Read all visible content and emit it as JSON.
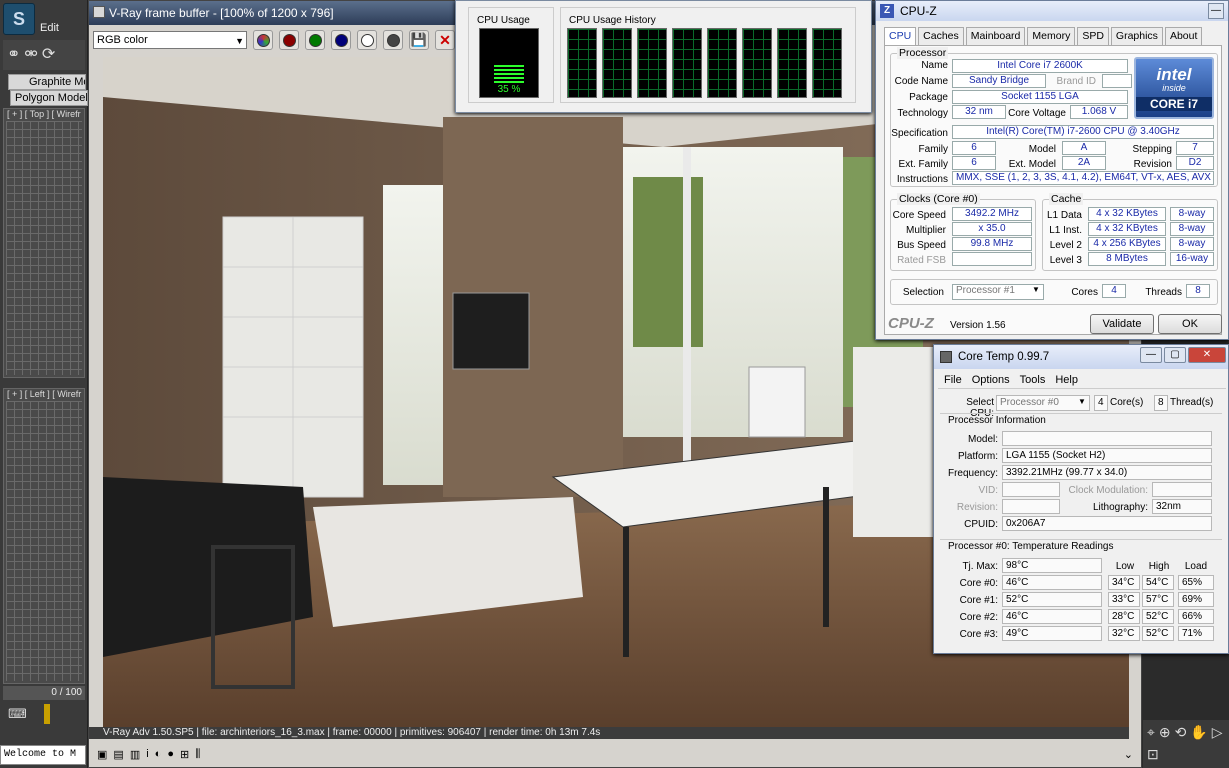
{
  "max": {
    "edit_label": "Edit",
    "ribbon1": "Graphite Mo",
    "ribbon2": "Polygon Modeli",
    "vp_top": "[ + ] [ Top ] [ Wirefr",
    "vp_left": "[ + ] [ Left ] [ Wirefr",
    "frame": "0 / 100",
    "welcome": "Welcome to M"
  },
  "vfb": {
    "title": "V-Ray frame buffer - [100% of 1200 x 796]",
    "channel": "RGB color",
    "status": "V-Ray Adv 1.50.SP5 | file: archinteriors_16_3.max | frame: 00000 | primitives: 906407 | render time: 0h 13m 7.4s"
  },
  "taskmgr": {
    "usage_label": "CPU Usage",
    "history_label": "CPU Usage History",
    "usage_value": "35 %",
    "usage_fraction": 0.35
  },
  "cpuz": {
    "title": "CPU-Z",
    "tabs": [
      "CPU",
      "Caches",
      "Mainboard",
      "Memory",
      "SPD",
      "Graphics",
      "About"
    ],
    "processor_legend": "Processor",
    "name_label": "Name",
    "name": "Intel Core i7 2600K",
    "codename_label": "Code Name",
    "codename": "Sandy Bridge",
    "brandid_label": "Brand ID",
    "package_label": "Package",
    "package": "Socket 1155 LGA",
    "technology_label": "Technology",
    "technology": "32 nm",
    "voltage_label": "Core Voltage",
    "voltage": "1.068 V",
    "spec_label": "Specification",
    "spec": "Intel(R) Core(TM) i7-2600 CPU @ 3.40GHz",
    "family_label": "Family",
    "family": "6",
    "model_label": "Model",
    "model": "A",
    "stepping_label": "Stepping",
    "stepping": "7",
    "extfamily_label": "Ext. Family",
    "extfamily": "6",
    "extmodel_label": "Ext. Model",
    "extmodel": "2A",
    "revision_label": "Revision",
    "revision": "D2",
    "instructions_label": "Instructions",
    "instructions": "MMX, SSE (1, 2, 3, 3S, 4.1, 4.2), EM64T, VT-x, AES, AVX",
    "clocks_legend": "Clocks (Core #0)",
    "corespeed_label": "Core Speed",
    "corespeed": "3492.2 MHz",
    "multiplier_label": "Multiplier",
    "multiplier": "x 35.0",
    "busspeed_label": "Bus Speed",
    "busspeed": "99.8 MHz",
    "ratedfsb_label": "Rated FSB",
    "cache_legend": "Cache",
    "l1d_label": "L1 Data",
    "l1d": "4 x 32 KBytes",
    "l1d_way": "8-way",
    "l1i_label": "L1 Inst.",
    "l1i": "4 x 32 KBytes",
    "l1i_way": "8-way",
    "l2_label": "Level 2",
    "l2": "4 x 256 KBytes",
    "l2_way": "8-way",
    "l3_label": "Level 3",
    "l3": "8 MBytes",
    "l3_way": "16-way",
    "selection_label": "Selection",
    "selection": "Processor #1",
    "cores_label": "Cores",
    "cores": "4",
    "threads_label": "Threads",
    "threads": "8",
    "brand": "CPU-Z",
    "version": "Version 1.56",
    "validate": "Validate",
    "ok": "OK",
    "intel_top": "intel",
    "intel_inside": "inside",
    "intel_core": "CORE i7"
  },
  "coretemp": {
    "title": "Core Temp 0.99.7",
    "menu": [
      "File",
      "Options",
      "Tools",
      "Help"
    ],
    "selectcpu_label": "Select CPU:",
    "selectcpu": "Processor #0",
    "cores": "4",
    "cores_label": "Core(s)",
    "threads": "8",
    "threads_label": "Thread(s)",
    "procinfo_label": "Processor Information",
    "model_label": "Model:",
    "platform_label": "Platform:",
    "platform": "LGA 1155 (Socket H2)",
    "frequency_label": "Frequency:",
    "frequency": "3392.21MHz (99.77 x 34.0)",
    "vid_label": "VID:",
    "clockmod_label": "Clock Modulation:",
    "revision_label": "Revision:",
    "lithography_label": "Lithography:",
    "lithography": "32nm",
    "cpuid_label": "CPUID:",
    "cpuid": "0x206A7",
    "readings_label": "Processor #0: Temperature Readings",
    "col_low": "Low",
    "col_high": "High",
    "col_load": "Load",
    "tjmax_label": "Tj. Max:",
    "tjmax": "98°C",
    "rows": [
      {
        "label": "Core #0:",
        "temp": "46°C",
        "low": "34°C",
        "high": "54°C",
        "load": "65%"
      },
      {
        "label": "Core #1:",
        "temp": "52°C",
        "low": "33°C",
        "high": "57°C",
        "load": "69%"
      },
      {
        "label": "Core #2:",
        "temp": "46°C",
        "low": "28°C",
        "high": "52°C",
        "load": "66%"
      },
      {
        "label": "Core #3:",
        "temp": "49°C",
        "low": "32°C",
        "high": "52°C",
        "load": "71%"
      }
    ]
  },
  "colors": {
    "accent": "#1a2aa8",
    "graph_green": "#2cff2c"
  }
}
